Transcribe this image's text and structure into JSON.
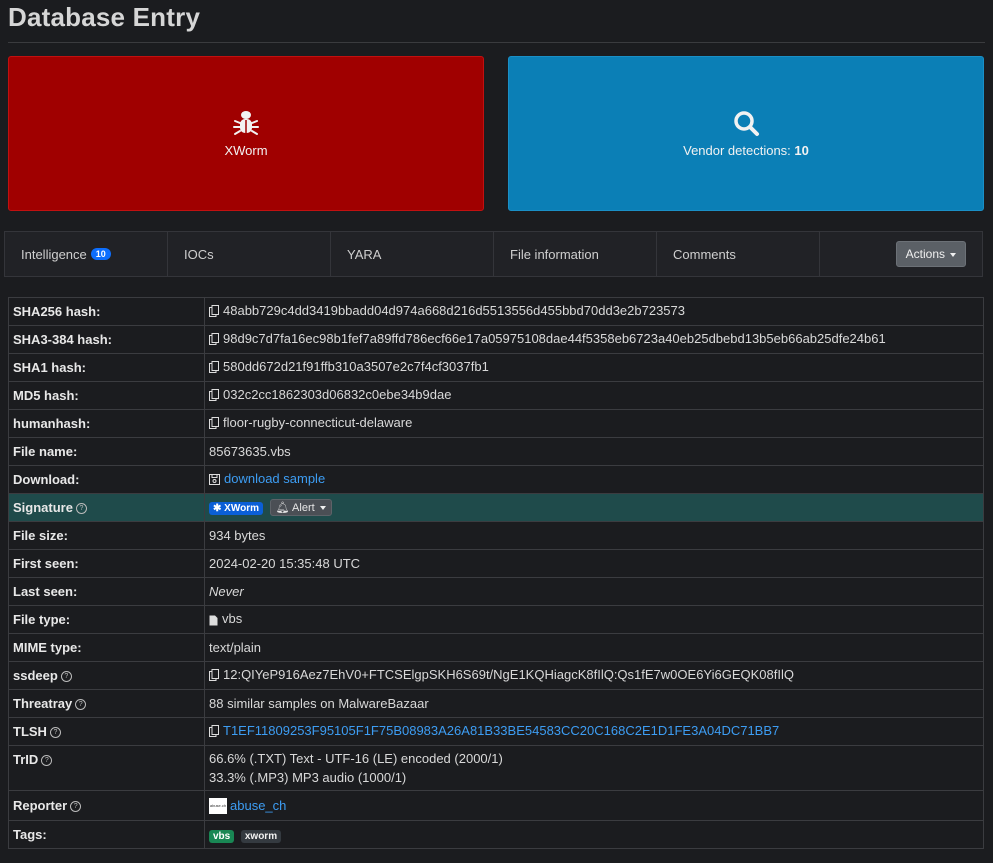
{
  "page": {
    "title": "Database Entry"
  },
  "cards": {
    "family": {
      "label": "XWorm",
      "icon": "bug-icon",
      "color": "#a00000"
    },
    "vendor": {
      "label_prefix": "Vendor detections: ",
      "count": "10",
      "icon": "search-icon",
      "color": "#0b7fb6"
    }
  },
  "tabs": {
    "intelligence": "Intelligence",
    "intelligence_badge": "10",
    "iocs": "IOCs",
    "yara": "YARA",
    "file_information": "File information",
    "comments": "Comments",
    "actions": "Actions"
  },
  "info": {
    "sha256": {
      "label": "SHA256 hash:",
      "value": "48abb729c4dd3419bbadd04d974a668d216d5513556d455bbd70dd3e2b723573"
    },
    "sha3": {
      "label": "SHA3-384 hash:",
      "value": "98d9c7d7fa16ec98b1fef7a89ffd786ecf66e17a05975108dae44f5358eb6723a40eb25dbebd13b5eb66ab25dfe24b61"
    },
    "sha1": {
      "label": "SHA1 hash:",
      "value": "580dd672d21f91ffb310a3507e2c7f4cf3037fb1"
    },
    "md5": {
      "label": "MD5 hash:",
      "value": "032c2cc1862303d06832c0ebe34b9dae"
    },
    "humanhash": {
      "label": "humanhash:",
      "value": "floor-rugby-connecticut-delaware"
    },
    "file_name": {
      "label": "File name:",
      "value": "85673635.vbs"
    },
    "download": {
      "label": "Download:",
      "value": "download sample"
    },
    "signature": {
      "label": "Signature",
      "badge": "XWorm",
      "alert": "Alert"
    },
    "file_size": {
      "label": "File size:",
      "value": "934 bytes"
    },
    "first_seen": {
      "label": "First seen:",
      "value": "2024-02-20 15:35:48 UTC"
    },
    "last_seen": {
      "label": "Last seen:",
      "value": "Never"
    },
    "file_type": {
      "label": "File type:",
      "value": "vbs"
    },
    "mime": {
      "label": "MIME type:",
      "value": "text/plain"
    },
    "ssdeep": {
      "label": "ssdeep",
      "value": "12:QIYeP916Aez7EhV0+FTCSElgpSKH6S69t/NgE1KQHiagcK8fIlQ:Qs1fE7w0OE6Yi6GEQK08fIlQ"
    },
    "threatray": {
      "label": "Threatray",
      "value": "88 similar samples on MalwareBazaar"
    },
    "tlsh": {
      "label": "TLSH",
      "value": "T1EF11809253F95105F1F75B08983A26A81B33BE54583CC20C168C2E1D1FE3A04DC71BB7"
    },
    "trid": {
      "label": "TrID",
      "line1": "66.6% (.TXT) Text - UTF-16 (LE) encoded (2000/1)",
      "line2": "33.3% (.MP3) MP3 audio (1000/1)"
    },
    "reporter": {
      "label": "Reporter",
      "value": "abuse_ch",
      "logo_text": "abuse.ch"
    },
    "tags": {
      "label": "Tags:",
      "items": [
        "vbs",
        "xworm"
      ]
    }
  },
  "colors": {
    "link": "#3d9df3",
    "signature_row": "#1f4b4b",
    "badge_blue": "#0b5fd6",
    "tag_green": "#198754"
  }
}
